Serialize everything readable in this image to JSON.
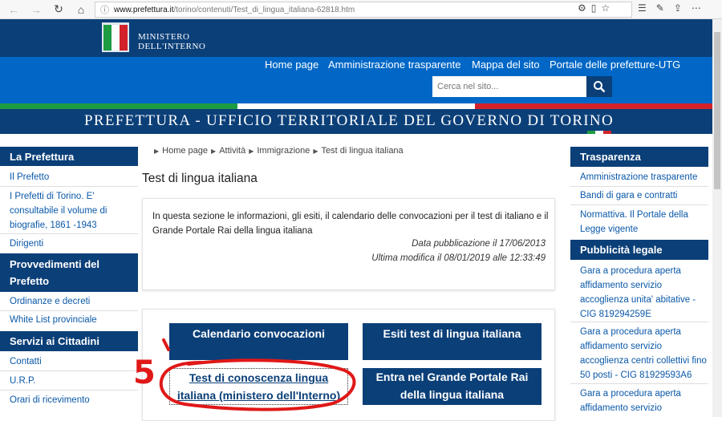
{
  "browser": {
    "url_host": "www.prefettura.it",
    "url_path": "/torino/contenuti/Test_di_lingua_italiana-62818.htm"
  },
  "header": {
    "ministry_line1": "MINISTERO",
    "ministry_line2": "DELL'INTERNO",
    "nav": [
      "Home page",
      "Amministrazione trasparente",
      "Mappa del sito",
      "Portale delle prefetture-UTG"
    ],
    "search_placeholder": "Cerca nel sito...",
    "prefecture_title": "PREFETTURA - UFFICIO TERRITORIALE DEL GOVERNO DI TORINO"
  },
  "left_sidebar": {
    "section1_title": "La Prefettura",
    "section1_links": [
      "Il Prefetto",
      "I Prefetti di Torino. E' consultabile il volume di biografie, 1861 -1943",
      "Dirigenti"
    ],
    "section2_title": "Provvedimenti del Prefetto",
    "section2_links": [
      "Ordinanze e decreti",
      "White List provinciale"
    ],
    "section3_title": "Servizi ai Cittadini",
    "section3_links": [
      "Contatti",
      "U.R.P.",
      "Orari di ricevimento"
    ]
  },
  "breadcrumb": [
    "Home page",
    "Attività",
    "Immigrazione",
    "Test di lingua italiana"
  ],
  "main": {
    "title": "Test di lingua italiana",
    "intro": "In questa sezione le informazioni, gli esiti, il calendario delle convocazioni per il test di italiano e il Grande Portale Rai della lingua italiana",
    "published": "Data pubblicazione il 17/06/2013",
    "modified": "Ultima modifica il 08/01/2019 alle 12:33:49",
    "tiles": [
      "Calendario convocazioni",
      "Esiti test di lingua italiana",
      "Test di conoscenza lingua italiana (ministero dell'Interno)",
      "Entra nel Grande Portale Rai della lingua italiana"
    ]
  },
  "right_sidebar": {
    "section1_title": "Trasparenza",
    "section1_links": [
      "Amministrazione trasparente",
      "Bandi di gara e contratti",
      "Normattiva. Il Portale della Legge vigente"
    ],
    "section2_title": "Pubblicità legale",
    "section2_links": [
      "Gara a procedura aperta affidamento servizio accoglienza unita' abitative - CIG 819294259E",
      "Gara a procedura aperta affidamento servizio accoglienza centri collettivi fino 50 posti - CIG 81929593A6",
      "Gara a procedura aperta affidamento servizio"
    ]
  },
  "annotation": {
    "label": "5",
    "color": "#e01818"
  },
  "colors": {
    "dark_blue": "#0b3f78",
    "blue": "#0067c6",
    "link": "#0a58a8",
    "italy_green": "#1e9c42",
    "italy_red": "#d2232a"
  }
}
